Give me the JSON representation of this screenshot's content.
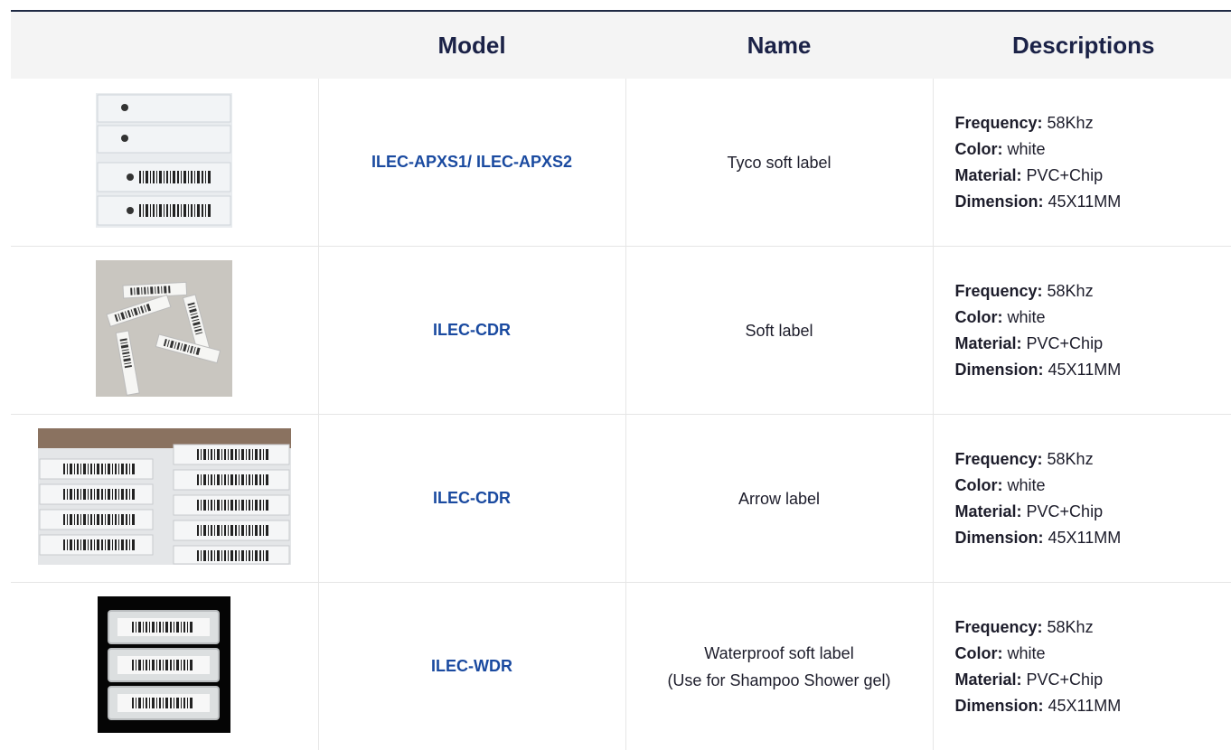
{
  "table": {
    "headers": [
      "",
      "Model",
      "Name",
      "Descriptions"
    ],
    "rows": [
      {
        "image_icon": "apxs-labels-photo",
        "model": "ILEC-APXS1/ ILEC-APXS2",
        "name_line1": "Tyco soft label",
        "name_line2": "",
        "desc": {
          "frequency_label": "Frequency:",
          "frequency_value": " 58Khz",
          "color_label": "Color:",
          "color_value": " white",
          "material_label": "Material:",
          "material_value": " PVC+Chip",
          "dimension_label": "Dimension:",
          "dimension_value": " 45X11MM"
        }
      },
      {
        "image_icon": "scattered-labels-photo",
        "model": "ILEC-CDR",
        "name_line1": "Soft label",
        "name_line2": "",
        "desc": {
          "frequency_label": "Frequency:",
          "frequency_value": " 58Khz",
          "color_label": "Color:",
          "color_value": " white",
          "material_label": "Material:",
          "material_value": " PVC+Chip",
          "dimension_label": "Dimension:",
          "dimension_value": " 45X11MM"
        }
      },
      {
        "image_icon": "arrow-labels-photo",
        "model": "ILEC-CDR",
        "name_line1": "Arrow label",
        "name_line2": "",
        "desc": {
          "frequency_label": "Frequency:",
          "frequency_value": " 58Khz",
          "color_label": "Color:",
          "color_value": " white",
          "material_label": "Material:",
          "material_value": " PVC+Chip",
          "dimension_label": "Dimension:",
          "dimension_value": " 45X11MM"
        }
      },
      {
        "image_icon": "waterproof-labels-photo",
        "model": "ILEC-WDR",
        "name_line1": "Waterproof soft label",
        "name_line2": "(Use for Shampoo Shower gel)",
        "desc": {
          "frequency_label": "Frequency:",
          "frequency_value": " 58Khz",
          "color_label": "Color:",
          "color_value": " white",
          "material_label": "Material:",
          "material_value": " PVC+Chip",
          "dimension_label": "Dimension:",
          "dimension_value": " 45X11MM"
        }
      }
    ]
  },
  "colors": {
    "header_bg": "#f4f4f4",
    "header_text": "#1b2247",
    "model_text": "#1a4aa0",
    "border": "#e6e6e6",
    "top_rule": "#1f2a44"
  }
}
